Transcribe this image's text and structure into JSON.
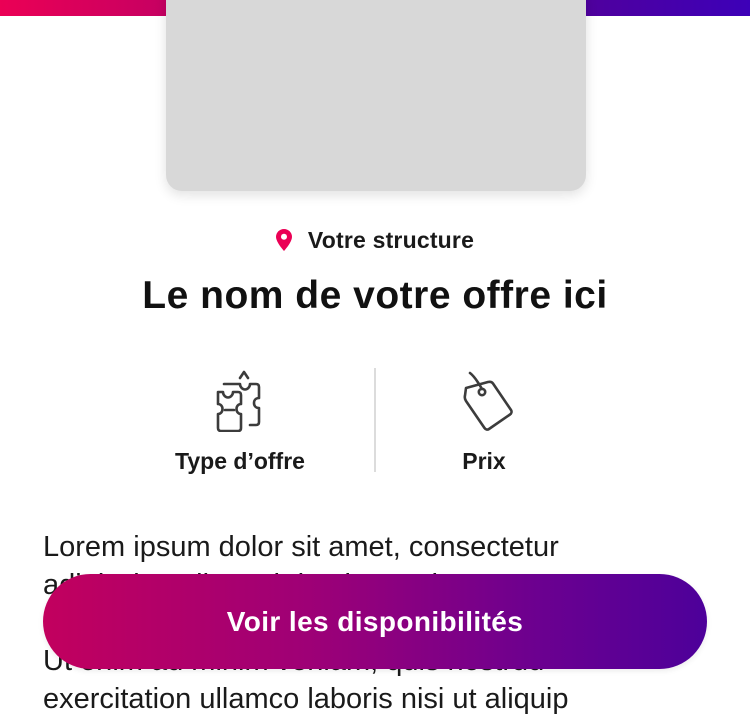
{
  "header": {
    "gradient_colors": [
      "#eb0055",
      "#a00070",
      "#52009a",
      "#3d00b8"
    ]
  },
  "offer": {
    "venue_icon": "location-pin-icon",
    "venue": "Votre structure",
    "title": "Le nom de votre offre ici"
  },
  "info": {
    "type_icon": "tickets-icon",
    "type_label": "Type d’offre",
    "price_icon": "price-tag-icon",
    "price_label": "Prix"
  },
  "description": {
    "line1": "Lorem ipsum dolor sit amet, consectetur",
    "line2": "adipiscing elit, sed do eiusmod tempor",
    "line3": "Ut enim ad minim veniam, quis nostrud",
    "line4": "exercitation ullamco laboris nisi ut aliquip"
  },
  "cta": {
    "label": "Voir les disponibilités"
  },
  "colors": {
    "accent": "#eb0055",
    "cta_start": "#c2005e",
    "cta_end": "#4d009a",
    "image_placeholder": "#d8d8d8"
  }
}
